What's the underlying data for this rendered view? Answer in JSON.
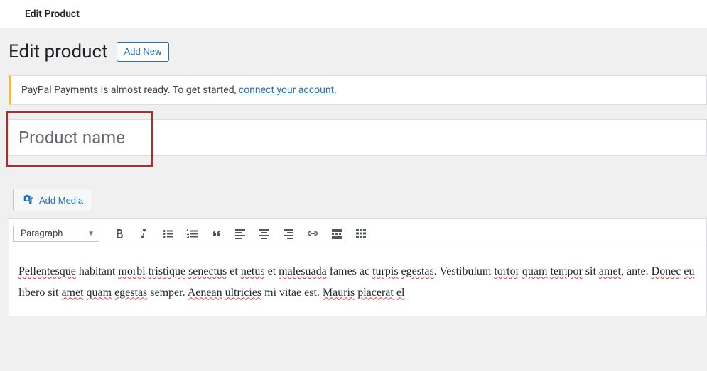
{
  "top_bar": {
    "title": "Edit Product"
  },
  "header": {
    "heading": "Edit product",
    "add_new_label": "Add New"
  },
  "notice": {
    "text_prefix": "PayPal Payments is almost ready. To get started, ",
    "link_text": "connect your account",
    "text_suffix": "."
  },
  "title_field": {
    "placeholder": "Product name",
    "value": ""
  },
  "media": {
    "add_media_label": "Add Media"
  },
  "toolbar": {
    "format_label": "Paragraph"
  },
  "content": {
    "t1": "Pellentesque",
    "t2": " habitant ",
    "t3": "morbi",
    "t4": " ",
    "t5": "tristique",
    "t6": " ",
    "t7": "senectus",
    "t8": " et ",
    "t9": "netus",
    "t10": " et ",
    "t11": "malesuada",
    "t12": " fames ac ",
    "t13": "turpis",
    "t14": " ",
    "t15": "egestas",
    "t16": ". Vestibulum ",
    "t17": "tortor",
    "t18": " ",
    "t19": "quam",
    "t19b": " ",
    "t20": "tempor",
    "t21": " sit ",
    "t22": "amet",
    "t23": ", ante. ",
    "t24": "Donec",
    "t25": " ",
    "t26": "eu",
    "t27": " libero sit ",
    "t28": "amet",
    "t29": " ",
    "t30": "quam",
    "t31": " ",
    "t32": "egestas",
    "t33": " semper. ",
    "t34": "Aenean",
    "t35": " ",
    "t36": "ultricies",
    "t37": " mi vitae est. ",
    "t38": "Mauris",
    "t39": " ",
    "t40": "placerat",
    "t41": " ",
    "t42": "el"
  }
}
